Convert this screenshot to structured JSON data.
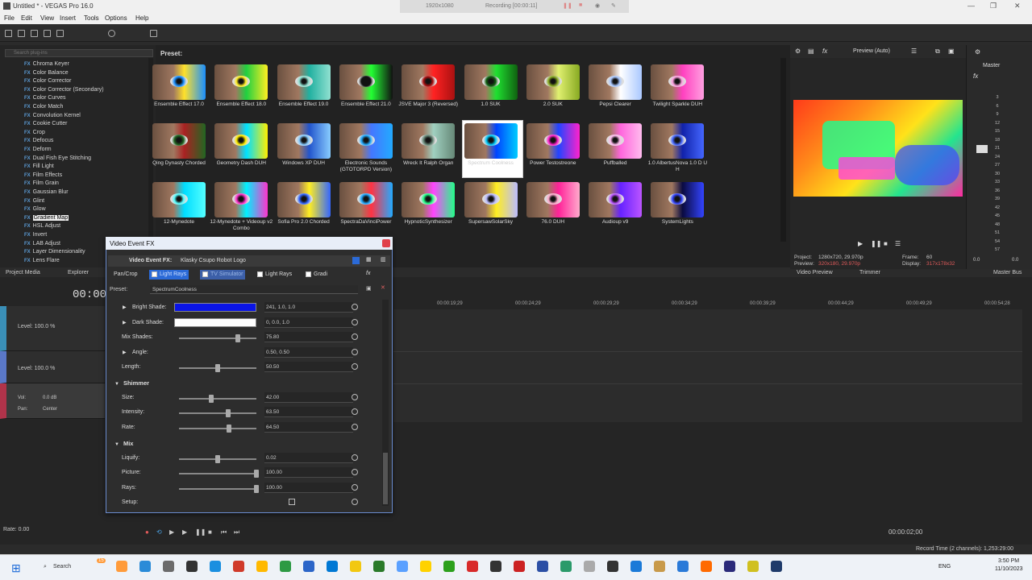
{
  "window": {
    "title": "Untitled * - VEGAS Pro 16.0",
    "recording_resolution": "1920x1080",
    "recording_status": "Recording [00:00:11]"
  },
  "menu": [
    "File",
    "Edit",
    "View",
    "Insert",
    "Tools",
    "Options",
    "Help"
  ],
  "plugins": {
    "search_placeholder": "Search plug-ins",
    "items": [
      "Chroma Keyer",
      "Color Balance",
      "Color Corrector",
      "Color Corrector (Secondary)",
      "Color Curves",
      "Color Match",
      "Convolution Kernel",
      "Cookie Cutter",
      "Crop",
      "Defocus",
      "Deform",
      "Dual Fish Eye Stitching",
      "Fill Light",
      "Film Effects",
      "Film Grain",
      "Gaussian Blur",
      "Glint",
      "Glow",
      "Gradient Map",
      "HSL Adjust",
      "Invert",
      "LAB Adjust",
      "Layer Dimensionality",
      "Lens Flare"
    ],
    "fx_tag": "FX",
    "selected": "Gradient Map"
  },
  "presets": {
    "label": "Preset:",
    "row1": [
      "Ensemble Effect 17.0",
      "Ensemble Effect 18.0",
      "Ensemble Effect 19.0",
      "Ensemble Effect 21.0",
      "JSVE Major 3 (Reversed)",
      "1.0 SUK",
      "2.0 SUK",
      "Pepsi Clearer",
      "Twilight Sparkle DUH"
    ],
    "row2": [
      "Qing Dynasty Chorded",
      "Geometry Dash DUH",
      "Windows XP DUH",
      "Electronic Sounds (GTOTORPD Version)",
      "Wreck It Ralph Organ",
      "Spectrum Coolness",
      "Power Testostreone",
      "Puffballed",
      "1.0 AlbertusNova 1.0 D U H"
    ],
    "row3": [
      "12-Mynedote",
      "12-Mynedote + Videoup v2 Combo",
      "Sofia Pro 2.0 Chorded",
      "SpectraDaVinciPower",
      "HypnoticSynthesizer",
      "SupersawSolarSky",
      "76.0 DUH",
      "Audioup v9",
      "SystemLights"
    ],
    "selected": "Spectrum Coolness"
  },
  "preview": {
    "mode": "Preview (Auto)",
    "project_label": "Project:",
    "project_value": "1280x720, 29.970p",
    "preview_label": "Preview:",
    "preview_value": "320x180, 29.970p",
    "frame_label": "Frame:",
    "frame_value": "60",
    "display_label": "Display:",
    "display_value": "317x178x32",
    "tab_preview": "Video Preview",
    "tab_trimmer": "Trimmer"
  },
  "master": {
    "label": "Master",
    "tab": "Master Bus",
    "ticks": [
      "3",
      "6",
      "9",
      "12",
      "15",
      "18",
      "21",
      "24",
      "27",
      "30",
      "33",
      "36",
      "39",
      "42",
      "45",
      "48",
      "51",
      "54",
      "57"
    ],
    "bottom_left": "0.0",
    "bottom_right": "0.0"
  },
  "tabs": {
    "project_media": "Project Media",
    "explorer": "Explorer"
  },
  "timeline": {
    "timecode": "00:00",
    "ruler": [
      "00:00:19;29",
      "00:00:24;29",
      "00:00:29;29",
      "00:00:34;29",
      "00:00:39;29",
      "00:00:44;29",
      "00:00:49;29",
      "00:00:54;28"
    ],
    "track1_level": "Level: 100.0 %",
    "track2_level": "Level: 100.0 %",
    "track3_vol": "Vol:",
    "track3_vol_value": "0.0 dB",
    "track3_pan": "Pan:",
    "track3_pan_value": "Center",
    "rate": "Rate: 0.00",
    "end_time": "00:00:02;00",
    "record_time": "Record Time (2 channels): 1,253:29:00"
  },
  "dialog": {
    "title": "Video Event FX",
    "header_label": "Video Event FX:",
    "header_value": "Klasky Csupo Robot Logo",
    "chain": [
      "Pan/Crop",
      "Light Rays",
      "TV Simulator",
      "Light Rays",
      "Gradi"
    ],
    "preset_label": "Preset:",
    "preset_value": "SpectrumCoolness",
    "params": {
      "bright_shade_label": "Bright Shade:",
      "bright_shade_value": "241, 1.0, 1.0",
      "bright_shade_color": "#0a14e6",
      "dark_shade_label": "Dark Shade:",
      "dark_shade_value": "0, 0.0, 1.0",
      "dark_shade_color": "#ffffff",
      "mix_shades_label": "Mix Shades:",
      "mix_shades_value": "75.80",
      "mix_shades_fraction": 0.758,
      "angle_label": "Angle:",
      "angle_value": "0.50, 0.50",
      "length_label": "Length:",
      "length_value": "50.50",
      "length_fraction": 0.505,
      "shimmer_label": "Shimmer",
      "size_label": "Size:",
      "size_value": "42.00",
      "size_fraction": 0.42,
      "intensity_label": "Intensity:",
      "intensity_value": "63.50",
      "intensity_fraction": 0.635,
      "rate_label": "Rate:",
      "rate_value": "64.50",
      "rate_fraction": 0.645,
      "mix_label": "Mix",
      "liquify_label": "Liquify:",
      "liquify_value": "0.02",
      "liquify_fraction": 0.5,
      "picture_label": "Picture:",
      "picture_value": "100.00",
      "picture_fraction": 1.0,
      "rays_label": "Rays:",
      "rays_value": "100.00",
      "rays_fraction": 1.0,
      "setup_label": "Setup:"
    }
  },
  "taskbar": {
    "search": "Search",
    "badge": "15",
    "lang": "ENG",
    "time": "3:50 PM",
    "date": "11/10/2023"
  }
}
